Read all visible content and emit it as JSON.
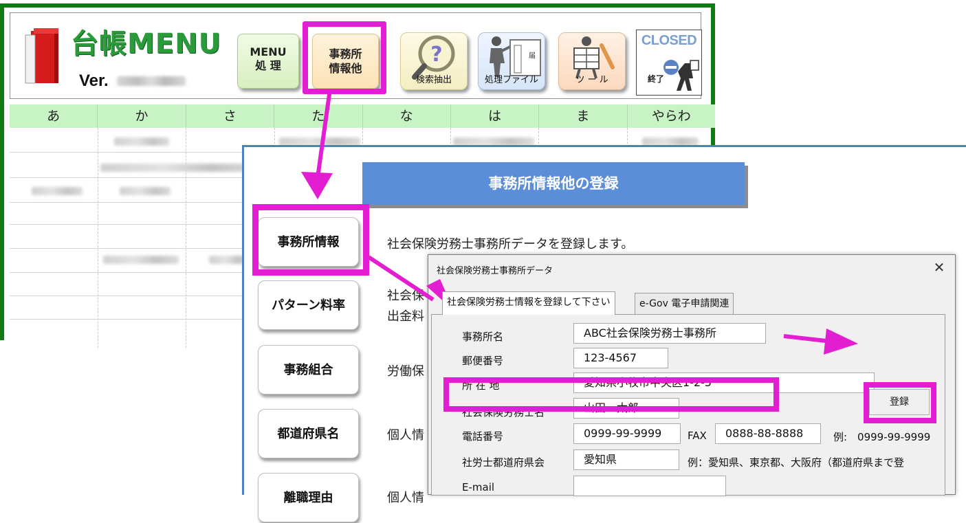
{
  "ledger": {
    "title": "台帳MENU",
    "version_label": "Ver.",
    "buttons": {
      "menu_line1": "MENU",
      "menu_line2": "処 理",
      "office_line1": "事務所",
      "office_line2": "情報他",
      "search": "検索抽出",
      "process_file": "処理ファイル",
      "tool": "ツ ー ル",
      "closed": "CLOSED",
      "closed_sub": "終了"
    },
    "kana_columns": [
      "あ",
      "か",
      "さ",
      "た",
      "な",
      "は",
      "ま",
      "やらわ"
    ]
  },
  "form": {
    "title": "事務所情報他の登録",
    "side_buttons": [
      {
        "label": "事務所情報",
        "description": "社会保険労務士事務所データを登録します。"
      },
      {
        "label": "パターン料率",
        "description": "社会保",
        "description2": "出金料"
      },
      {
        "label": "事務組合",
        "description": "労働保"
      },
      {
        "label": "都道府県名",
        "description": "個人情"
      },
      {
        "label": "離職理由",
        "description": "個人情"
      }
    ]
  },
  "dialog": {
    "title": "社会保険労務士事務所データ",
    "close": "✕",
    "tabs": [
      "社会保険労務士情報を登録して下さい",
      "e-Gov 電子申請関連"
    ],
    "register_button": "登録",
    "fields": {
      "office_name": {
        "label": "事務所名",
        "value": "ABC社会保険労務士事務所"
      },
      "postal_code": {
        "label": "郵便番号",
        "value": "123-4567"
      },
      "address": {
        "label": "所 在 地",
        "value": "愛知県小牧市中央区1-2-5"
      },
      "sharoushi_name": {
        "label": "社会保険労務士名",
        "value": "山田　太郎"
      },
      "phone": {
        "label": "電話番号",
        "value": "0999-99-9999"
      },
      "fax": {
        "label": "FAX",
        "value": "0888-88-8888"
      },
      "phone_example": "例:　0999-99-9999",
      "prefecture_assoc": {
        "label": "社労士都道府県会",
        "value": "愛知県"
      },
      "prefecture_example": "例：愛知県、東京都、大阪府（都道府県まで登",
      "email": {
        "label": "E-mail",
        "value": ""
      }
    }
  },
  "colors": {
    "frame_green": "#117b11",
    "highlight_magenta": "#e21dd2",
    "title_blue": "#5b8ed6",
    "kana_row_green": "#c8f3c4"
  }
}
